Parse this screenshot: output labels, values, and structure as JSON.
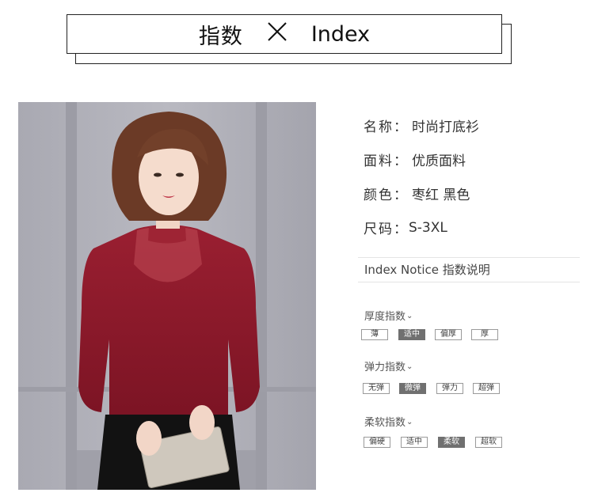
{
  "header": {
    "cn": "指数",
    "x": "╳",
    "en": "Index"
  },
  "info": {
    "name_label": "名称：",
    "name_value": "时尚打底衫",
    "fabric_label": "面料：",
    "fabric_value": "优质面料",
    "color_label": "颜色：",
    "color_value": "枣红 黑色",
    "size_label": "尺码：",
    "size_value": "S-3XL"
  },
  "notice": "Index Notice 指数说明",
  "indices": [
    {
      "title": "厚度指数",
      "options": [
        "薄",
        "适中",
        "偏厚",
        "厚"
      ],
      "selected": 1
    },
    {
      "title": "弹力指数",
      "options": [
        "无弹",
        "微弹",
        "弹力",
        "超弹"
      ],
      "selected": 1
    },
    {
      "title": "柔软指数",
      "options": [
        "偏硬",
        "适中",
        "柔软",
        "超软"
      ],
      "selected": 2
    }
  ],
  "colors": {
    "selected_bg": "#707070",
    "garment": "#8e1a2b"
  }
}
